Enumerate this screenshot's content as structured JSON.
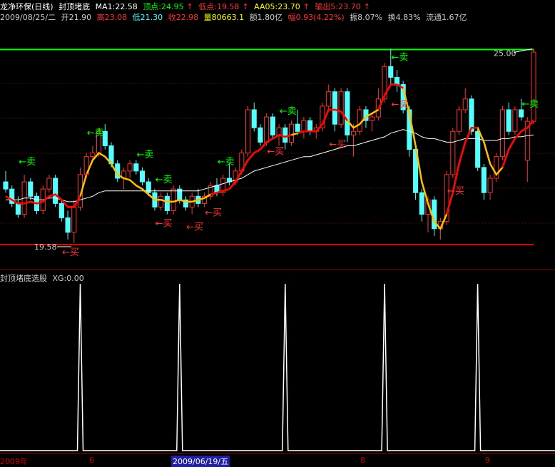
{
  "header": {
    "stock_name": "龙净环保(日线)",
    "indicator_name": "封顶堵底",
    "ma1": "MA1:22.58",
    "top": "顶点:24.95",
    "bottom": "低点:19.58",
    "aa05": "AA05:23.70",
    "output": "输出5:23.70",
    "date": "2009/08/25/二",
    "open": "开21.90",
    "high": "高23.08",
    "low": "低21.30",
    "close": "收22.98",
    "volume": "量80663.1",
    "amount": "额1.80亿",
    "change": "幅0.93(4.22%)",
    "amplitude": "振8.07%",
    "turnover": "换4.83%",
    "float": "流通1.67亿"
  },
  "sub_header": {
    "title": "封顶堵底选股",
    "xg": "XG:0.00"
  },
  "price_chart": {
    "top_value": "25.00",
    "bottom_value": "19.58",
    "buy_label": "买",
    "sell_label": "卖"
  },
  "date_bar": {
    "year": "2009年",
    "m6": "6",
    "selected": "2009/06/19/五",
    "m8": "8",
    "m9": "9"
  },
  "colors": {
    "up": "#ff3333",
    "down": "#54ffff",
    "ma_white": "#ffffff",
    "yellow_line": "#ffc000",
    "red_line": "#ff0000",
    "top_line": "#00ff00",
    "bottom_line": "#ff0000"
  },
  "chart_data": {
    "type": "candlestick",
    "top_level": 24.95,
    "bottom_level": 19.58,
    "candles": [
      [
        21.3,
        21.6,
        21.0,
        21.1
      ],
      [
        21.1,
        21.2,
        20.6,
        20.7
      ],
      [
        20.7,
        20.9,
        20.3,
        20.4
      ],
      [
        20.4,
        21.5,
        20.3,
        21.3
      ],
      [
        21.3,
        21.4,
        20.8,
        20.9
      ],
      [
        20.9,
        21.0,
        20.4,
        20.5
      ],
      [
        20.5,
        21.2,
        20.4,
        21.1
      ],
      [
        21.1,
        21.5,
        21.0,
        21.4
      ],
      [
        21.4,
        21.5,
        20.6,
        20.7
      ],
      [
        20.7,
        20.8,
        20.2,
        20.3
      ],
      [
        20.3,
        20.5,
        19.7,
        19.9
      ],
      [
        19.9,
        20.8,
        19.6,
        20.6
      ],
      [
        20.6,
        21.7,
        20.5,
        21.5
      ],
      [
        21.5,
        22.1,
        21.4,
        22.0
      ],
      [
        22.0,
        22.3,
        21.9,
        22.1
      ],
      [
        22.1,
        22.8,
        22.0,
        22.7
      ],
      [
        22.7,
        22.9,
        22.2,
        22.3
      ],
      [
        22.3,
        22.4,
        21.7,
        21.8
      ],
      [
        21.8,
        21.9,
        21.3,
        21.4
      ],
      [
        21.4,
        21.7,
        21.1,
        21.6
      ],
      [
        21.6,
        21.9,
        21.4,
        21.8
      ],
      [
        21.8,
        21.9,
        21.5,
        21.6
      ],
      [
        21.6,
        21.7,
        21.2,
        21.3
      ],
      [
        21.3,
        21.4,
        20.9,
        21.0
      ],
      [
        21.0,
        21.1,
        20.5,
        20.6
      ],
      [
        20.6,
        21.0,
        20.5,
        20.9
      ],
      [
        20.9,
        21.0,
        20.4,
        20.5
      ],
      [
        20.5,
        21.2,
        20.4,
        21.1
      ],
      [
        21.1,
        21.2,
        20.7,
        20.8
      ],
      [
        20.8,
        20.9,
        20.5,
        20.6
      ],
      [
        20.6,
        21.0,
        20.4,
        20.9
      ],
      [
        20.9,
        21.1,
        20.6,
        20.7
      ],
      [
        20.7,
        21.0,
        20.6,
        20.9
      ],
      [
        20.9,
        21.3,
        20.8,
        21.2
      ],
      [
        21.2,
        21.4,
        20.9,
        21.0
      ],
      [
        21.0,
        21.5,
        20.9,
        21.4
      ],
      [
        21.4,
        21.8,
        21.2,
        21.3
      ],
      [
        21.3,
        21.7,
        21.2,
        21.6
      ],
      [
        21.6,
        22.2,
        21.5,
        22.1
      ],
      [
        22.1,
        23.4,
        22.0,
        23.3
      ],
      [
        23.3,
        23.5,
        22.7,
        22.8
      ],
      [
        22.8,
        22.9,
        22.3,
        22.4
      ],
      [
        22.4,
        23.2,
        22.3,
        23.1
      ],
      [
        23.1,
        23.2,
        22.5,
        22.6
      ],
      [
        22.6,
        22.9,
        22.3,
        22.8
      ],
      [
        22.8,
        22.9,
        22.2,
        22.4
      ],
      [
        22.4,
        23.0,
        22.3,
        22.9
      ],
      [
        22.9,
        23.3,
        22.6,
        22.7
      ],
      [
        22.7,
        23.1,
        22.5,
        23.0
      ],
      [
        23.0,
        23.1,
        22.6,
        22.7
      ],
      [
        22.7,
        22.9,
        22.5,
        22.8
      ],
      [
        22.8,
        23.5,
        22.7,
        23.4
      ],
      [
        23.4,
        24.0,
        23.3,
        23.8
      ],
      [
        23.8,
        23.9,
        22.7,
        22.9
      ],
      [
        22.9,
        23.9,
        22.8,
        23.8
      ],
      [
        23.8,
        23.9,
        22.4,
        22.6
      ],
      [
        22.6,
        22.9,
        22.0,
        22.7
      ],
      [
        22.7,
        23.4,
        22.6,
        23.3
      ],
      [
        23.3,
        23.4,
        22.8,
        23.0
      ],
      [
        23.0,
        23.2,
        22.7,
        23.1
      ],
      [
        23.1,
        23.9,
        23.0,
        23.6
      ],
      [
        23.6,
        24.6,
        23.5,
        24.5
      ],
      [
        24.5,
        25.0,
        24.0,
        24.2
      ],
      [
        24.2,
        24.4,
        23.8,
        24.0
      ],
      [
        24.0,
        24.1,
        23.2,
        23.3
      ],
      [
        23.3,
        23.4,
        22.0,
        22.2
      ],
      [
        22.2,
        22.3,
        20.8,
        21.0
      ],
      [
        21.0,
        21.1,
        20.2,
        20.4
      ],
      [
        20.4,
        20.9,
        19.9,
        20.8
      ],
      [
        20.8,
        20.9,
        19.8,
        20.0
      ],
      [
        20.0,
        20.3,
        19.7,
        20.2
      ],
      [
        20.2,
        21.6,
        20.1,
        21.5
      ],
      [
        21.5,
        22.8,
        21.4,
        22.7
      ],
      [
        22.7,
        23.4,
        22.6,
        23.3
      ],
      [
        23.3,
        23.9,
        23.2,
        23.6
      ],
      [
        23.6,
        23.7,
        22.6,
        22.7
      ],
      [
        22.7,
        22.8,
        21.6,
        21.7
      ],
      [
        21.7,
        21.8,
        20.8,
        21.0
      ],
      [
        21.0,
        21.5,
        20.8,
        21.4
      ],
      [
        21.4,
        22.1,
        21.3,
        22.0
      ],
      [
        22.0,
        23.4,
        21.9,
        23.3
      ],
      [
        23.3,
        23.5,
        22.6,
        22.7
      ],
      [
        22.7,
        23.4,
        22.6,
        23.3
      ],
      [
        23.3,
        23.6,
        23.0,
        23.1
      ],
      [
        21.9,
        23.1,
        21.3,
        22.98
      ],
      [
        22.98,
        25.0,
        22.9,
        24.9
      ]
    ],
    "ma_white": [
      20.8,
      20.8,
      20.8,
      20.85,
      20.85,
      20.8,
      20.8,
      20.85,
      20.85,
      20.8,
      20.75,
      20.75,
      20.8,
      20.85,
      20.9,
      21.0,
      21.05,
      21.05,
      21.05,
      21.05,
      21.05,
      21.05,
      21.05,
      21.05,
      21.05,
      21.05,
      21.05,
      21.05,
      21.05,
      21.05,
      21.05,
      21.05,
      21.1,
      21.15,
      21.2,
      21.25,
      21.3,
      21.35,
      21.4,
      21.5,
      21.6,
      21.65,
      21.7,
      21.75,
      21.8,
      21.85,
      21.9,
      21.95,
      22.0,
      22.0,
      22.05,
      22.1,
      22.15,
      22.2,
      22.25,
      22.3,
      22.3,
      22.35,
      22.4,
      22.45,
      22.5,
      22.55,
      22.65,
      22.7,
      22.75,
      22.7,
      22.65,
      22.55,
      22.5,
      22.5,
      22.45,
      22.4,
      22.4,
      22.45,
      22.5,
      22.5,
      22.5,
      22.45,
      22.45,
      22.45,
      22.5,
      22.5,
      22.55,
      22.55,
      22.58,
      22.6
    ],
    "yellow_line": [
      20.9,
      20.8,
      20.7,
      20.7,
      20.75,
      20.7,
      20.75,
      20.9,
      20.95,
      20.8,
      20.6,
      20.6,
      20.9,
      21.5,
      21.9,
      22.1,
      22.0,
      21.8,
      21.5,
      21.4,
      21.35,
      21.2,
      21.1,
      20.95,
      20.8,
      20.8,
      20.75,
      20.75,
      20.8,
      20.75,
      20.75,
      20.8,
      20.85,
      20.95,
      21.0,
      21.05,
      21.1,
      21.3,
      21.6,
      21.9,
      22.1,
      22.2,
      22.4,
      22.5,
      22.6,
      22.55,
      22.6,
      22.65,
      22.7,
      22.7,
      22.7,
      22.9,
      23.3,
      23.3,
      23.25,
      23.0,
      22.8,
      22.9,
      23.1,
      23.2,
      23.3,
      23.7,
      24.0,
      24.0,
      23.9,
      23.2,
      22.3,
      21.3,
      20.7,
      20.2,
      20.0,
      20.4,
      21.0,
      21.8,
      22.4,
      22.8,
      22.8,
      22.4,
      21.8,
      21.5,
      21.7,
      22.2,
      22.5,
      22.7,
      22.8,
      23.0
    ],
    "red_line_ranges": [
      [
        0,
        12
      ],
      [
        13,
        13
      ],
      [
        33,
        46
      ],
      [
        47,
        55
      ],
      [
        60,
        64
      ],
      [
        71,
        76
      ],
      [
        80,
        86
      ]
    ],
    "sell_labels": [
      3,
      14,
      22,
      25,
      35,
      45,
      63,
      84
    ],
    "buy_labels": [
      10,
      25,
      30,
      33,
      43,
      53,
      63,
      72
    ]
  },
  "sub_chart": {
    "peaks": [
      12,
      28,
      45,
      61,
      76
    ]
  }
}
